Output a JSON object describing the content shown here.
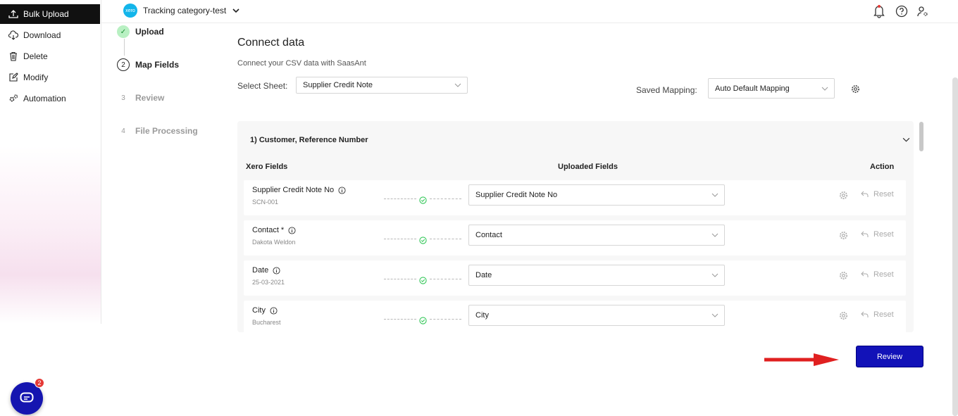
{
  "sidebar": {
    "items": [
      {
        "label": "Bulk Upload",
        "icon": "upload-icon",
        "active": true
      },
      {
        "label": "Download",
        "icon": "cloud-download-icon"
      },
      {
        "label": "Delete",
        "icon": "trash-icon"
      },
      {
        "label": "Modify",
        "icon": "edit-icon"
      },
      {
        "label": "Automation",
        "icon": "gears-icon"
      }
    ]
  },
  "header": {
    "org_logo": "xero",
    "org_name": "Tracking category-test"
  },
  "steps": [
    {
      "num": "✓",
      "label": "Upload",
      "state": "done"
    },
    {
      "num": "2",
      "label": "Map Fields",
      "state": "current"
    },
    {
      "num": "3",
      "label": "Review",
      "state": "pending"
    },
    {
      "num": "4",
      "label": "File Processing",
      "state": "pending"
    }
  ],
  "main": {
    "title": "Connect data",
    "subtitle": "Connect your CSV data with SaasAnt",
    "select_sheet_label": "Select Sheet:",
    "select_sheet_value": "Supplier Credit Note",
    "saved_mapping_label": "Saved Mapping:",
    "saved_mapping_value": "Auto Default Mapping"
  },
  "panel": {
    "heading": "1) Customer, Reference Number",
    "col_xero": "Xero Fields",
    "col_uploaded": "Uploaded Fields",
    "col_action": "Action",
    "rows": [
      {
        "field": "Supplier Credit Note No",
        "required": "",
        "sample": "SCN-001",
        "mapped": "Supplier Credit Note No",
        "reset": "Reset"
      },
      {
        "field": "Contact",
        "required": "*",
        "sample": "Dakota Weldon",
        "mapped": "Contact",
        "reset": "Reset"
      },
      {
        "field": "Date",
        "required": "",
        "sample": "25-03-2021",
        "mapped": "Date",
        "reset": "Reset"
      },
      {
        "field": "City",
        "required": "",
        "sample": "Bucharest",
        "mapped": "City",
        "reset": "Reset"
      }
    ]
  },
  "actions": {
    "review_label": "Review"
  },
  "chat": {
    "badge": "2"
  },
  "colors": {
    "accent": "#1212b8",
    "success": "#34c759",
    "arrow": "#e02020"
  }
}
